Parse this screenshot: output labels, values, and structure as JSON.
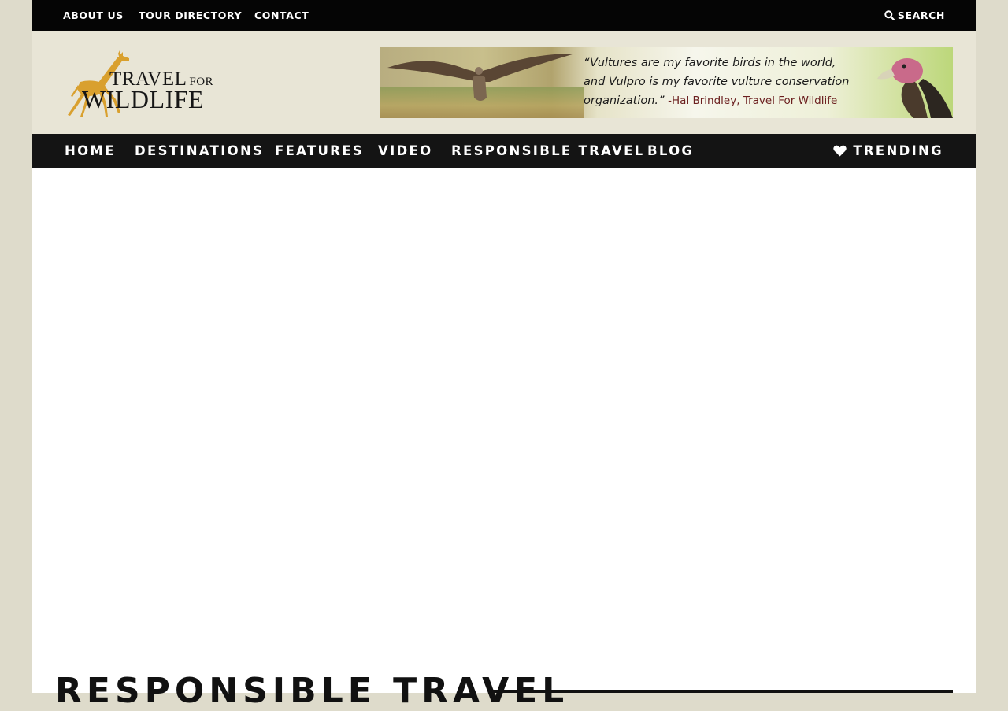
{
  "topbar": {
    "links": [
      "ABOUT US",
      "TOUR DIRECTORY",
      "CONTACT"
    ],
    "search_label": "SEARCH"
  },
  "header": {
    "logo": {
      "line1": "TRAVEL",
      "line1_small": "FOR",
      "line2": "WILDLIFE",
      "accent_color": "#d9a02e"
    },
    "banner": {
      "quote_line1": "“Vultures are my favorite birds in the world,",
      "quote_line2": "and Vulpro is my favorite vulture conservation",
      "quote_line3": "organization.”",
      "author": "-Hal Brindley, Travel For Wildlife"
    }
  },
  "nav": {
    "items": [
      "HOME",
      "DESTINATIONS",
      "FEATURES",
      "VIDEO",
      "RESPONSIBLE TRAVEL",
      "BLOG"
    ],
    "trending_label": "TRENDING"
  },
  "main": {
    "page_title": "RESPONSIBLE TRAVEL"
  },
  "colors": {
    "page_bg": "#dedbcb",
    "header_bg": "#e8e5d6",
    "topbar_bg": "#050505",
    "nav_bg": "#141414",
    "logo_gold": "#d9a02e"
  }
}
